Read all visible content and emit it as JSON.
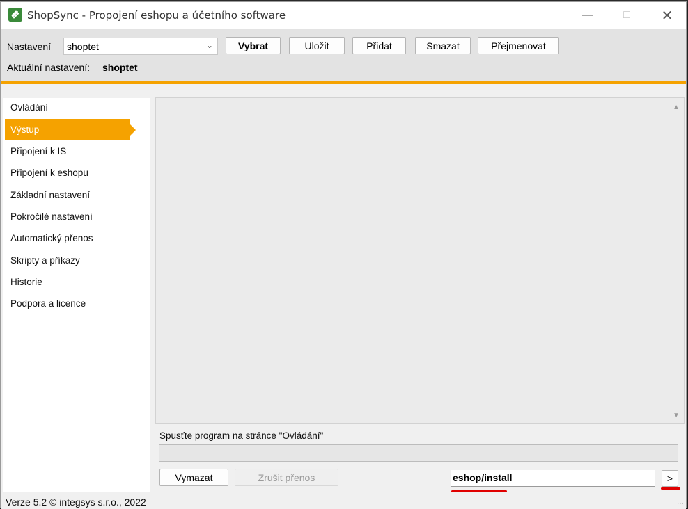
{
  "window": {
    "title": "ShopSync - Propojení eshopu a účetního software",
    "controls": [
      "minimize",
      "maximize",
      "close"
    ]
  },
  "toolbar": {
    "settings_label": "Nastavení",
    "settings_value": "shoptet",
    "buttons": {
      "select": "Vybrat",
      "save": "Uložit",
      "add": "Přidat",
      "delete": "Smazat",
      "rename": "Přejmenovat"
    },
    "current_label": "Aktuální nastavení:",
    "current_value": "shoptet"
  },
  "sidebar": {
    "items": [
      {
        "label": "Ovládání"
      },
      {
        "label": "Výstup",
        "active": true
      },
      {
        "label": "Připojení k IS"
      },
      {
        "label": "Připojení k eshopu"
      },
      {
        "label": "Základní nastavení"
      },
      {
        "label": "Pokročilé nastavení"
      },
      {
        "label": "Automatický přenos"
      },
      {
        "label": "Skripty a příkazy"
      },
      {
        "label": "Historie"
      },
      {
        "label": "Podpora a licence"
      }
    ]
  },
  "main": {
    "output_text": "",
    "status_text": "Spusťte program na stránce \"Ovládání\"",
    "progress": 0,
    "clear_button": "Vymazat",
    "cancel_button": "Zrušit přenos",
    "command_value": "eshop/install",
    "run_button": ">"
  },
  "footer": {
    "text": "Verze 5.2  © integsys s.r.o., 2022"
  },
  "colors": {
    "accent": "#f5a200",
    "annotation": "#e00000"
  }
}
